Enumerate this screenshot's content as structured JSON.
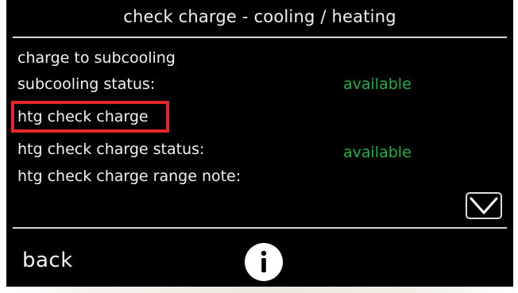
{
  "header": {
    "title": "check charge - cooling / heating"
  },
  "rows": [
    {
      "label": "charge to subcooling",
      "value": ""
    },
    {
      "label": "subcooling status:",
      "value": "available"
    },
    {
      "label": "htg check charge",
      "value": ""
    },
    {
      "label": "htg check charge status:",
      "value": "available"
    },
    {
      "label": "htg check charge range note:",
      "value": ""
    }
  ],
  "footer": {
    "back_label": "back",
    "info_icon": "info-icon"
  },
  "colors": {
    "background": "#000000",
    "text": "#f2f2f2",
    "status_value": "#27b04a",
    "highlight": "#e5262b"
  }
}
